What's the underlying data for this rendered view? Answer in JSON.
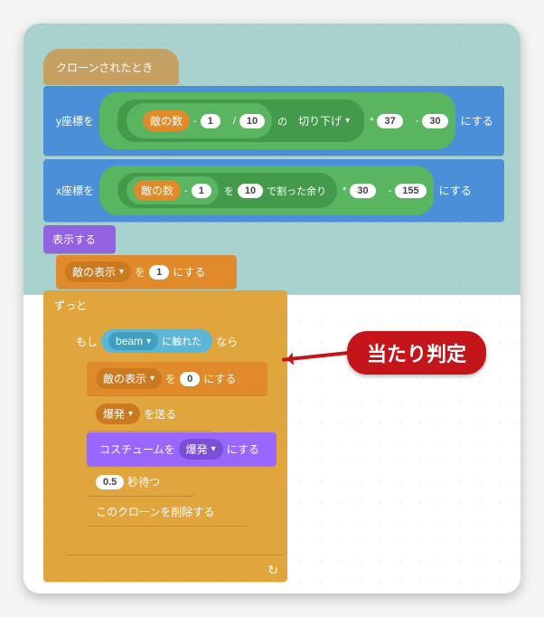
{
  "hat": {
    "label": "クローンされたとき"
  },
  "setY": {
    "prefix": "y座標を",
    "var": "敵の数",
    "minus1": "1",
    "div": "10",
    "of": "の",
    "floor": "切り下げ",
    "times": "37",
    "minus2": "30",
    "suffix": "にする"
  },
  "setX": {
    "prefix": "x座標を",
    "var": "敵の数",
    "minus1": "1",
    "wo": "を",
    "mod": "10",
    "modlabel": "で割った余り",
    "times": "30",
    "minus2": "155",
    "suffix": "にする"
  },
  "show": {
    "label": "表示する"
  },
  "setDisp": {
    "dropdown": "敵の表示",
    "wo": "を",
    "val": "1",
    "suffix": "にする"
  },
  "forever": {
    "label": "ずっと"
  },
  "ifBlock": {
    "if": "もし",
    "touch_prefix": "",
    "beam": "beam",
    "touch_suffix": "に触れた",
    "then": "なら"
  },
  "setDisp0": {
    "dropdown": "敵の表示",
    "wo": "を",
    "val": "0",
    "suffix": "にする"
  },
  "broadcast": {
    "dropdown": "爆発",
    "suffix": "を送る"
  },
  "costume": {
    "prefix": "コスチュームを",
    "dropdown": "爆発",
    "suffix": "にする"
  },
  "wait": {
    "val": "0.5",
    "suffix": "秒待つ"
  },
  "deleteClone": {
    "label": "このクローンを削除する"
  },
  "callout": {
    "text": "当たり判定"
  },
  "symbols": {
    "minus": "-",
    "slash": "/",
    "star": "*",
    "loop": "↻",
    "chev": "▾"
  }
}
